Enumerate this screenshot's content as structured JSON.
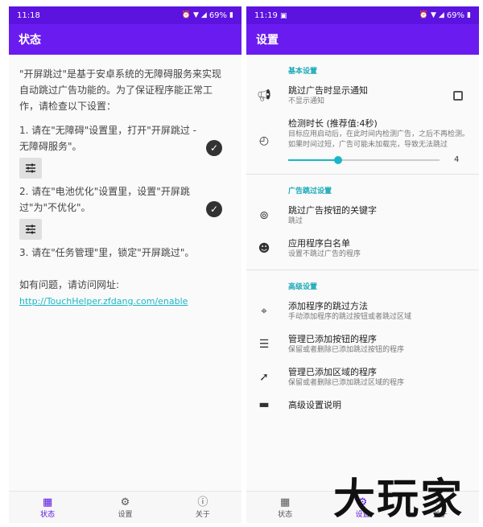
{
  "left": {
    "status": {
      "time": "11:18",
      "battery": "69%"
    },
    "title": "状态",
    "intro": "\"开屏跳过\"是基于安卓系统的无障碍服务来实现自动跳过广告功能的。为了保证程序能正常工作，请检查以下设置：",
    "steps": [
      "1. 请在\"无障碍\"设置里，打开\"开屏跳过 - 无障碍服务\"。",
      "2. 请在\"电池优化\"设置里，设置\"开屏跳过\"为\"不优化\"。",
      "3. 请在\"任务管理\"里，锁定\"开屏跳过\"。"
    ],
    "help_label": "如有问题，请访问网址:",
    "help_url": "http://TouchHelper.zfdang.com/enable",
    "nav": [
      "状态",
      "设置",
      "关于"
    ]
  },
  "right": {
    "status": {
      "time": "11:19",
      "battery": "69%"
    },
    "title": "设置",
    "sections": {
      "basic": "基本设置",
      "ad": "广告跳过设置",
      "advanced": "高级设置"
    },
    "prefs": {
      "notify_title": "跳过广告时显示通知",
      "notify_summary": "不显示通知",
      "duration_title": "检测时长 (推荐值:4秒)",
      "duration_summary": "目标应用启动后，在此时间内检测广告，之后不再检测。如果时间过短，广告可能未加载完，导致无法跳过",
      "duration_value": "4",
      "duration_fraction": 0.33,
      "keyword_title": "跳过广告按钮的关键字",
      "keyword_summary": "跳过",
      "whitelist_title": "应用程序白名单",
      "whitelist_summary": "设置不跳过广告的程序",
      "add_method_title": "添加程序的跳过方法",
      "add_method_summary": "手动添加程序的跳过按钮或者跳过区域",
      "manage_button_title": "管理已添加按钮的程序",
      "manage_button_summary": "保留或者删除已添加跳过按钮的程序",
      "manage_region_title": "管理已添加区域的程序",
      "manage_region_summary": "保留或者删除已添加跳过区域的程序",
      "advanced_help_title": "高级设置说明"
    },
    "nav": [
      "状态",
      "设置",
      "关于"
    ]
  },
  "watermark": "大玩家",
  "colors": {
    "primary": "#6a1cf0",
    "accent": "#19b7c6"
  }
}
